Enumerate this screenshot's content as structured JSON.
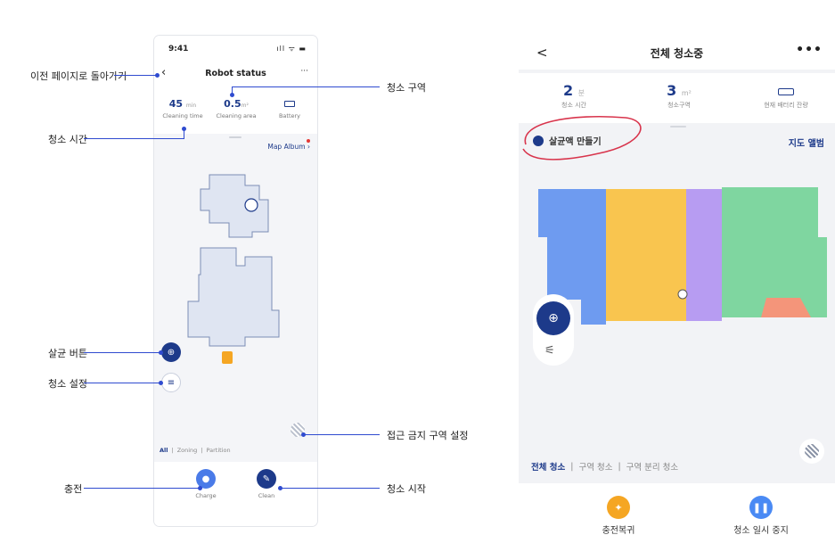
{
  "left_phone": {
    "status_time": "9:41",
    "status_icons": "ıll ᯤ ▬",
    "back_glyph": "‹",
    "title": "Robot status",
    "more_glyph": "···",
    "stats": [
      {
        "value": "45",
        "unit": "min",
        "label": "Cleaning time"
      },
      {
        "value": "0.5",
        "unit": "m²",
        "label": "Cleaning area"
      },
      {
        "value": "",
        "unit": "",
        "label": "Battery"
      }
    ],
    "map_album": "Map Album ›",
    "modes": {
      "all": "All",
      "zoning": "Zoning",
      "partition": "Partition"
    },
    "actions": [
      {
        "label": "Charge",
        "color": "#4a7be8"
      },
      {
        "label": "Clean",
        "color": "#1d3a8a"
      }
    ]
  },
  "annotations": {
    "back": "이전 페이지로 돌아가기",
    "area": "청소 구역",
    "time": "청소 시간",
    "disinfect": "살균 버튼",
    "settings": "청소 설정",
    "forbidden": "접근 금지 구역 설정",
    "charge": "충전",
    "start": "청소 시작"
  },
  "right_phone": {
    "back_glyph": "<",
    "title": "전체 청소중",
    "more_glyph": "•••",
    "stats": [
      {
        "value": "2",
        "unit": "분",
        "label": "청소 시간"
      },
      {
        "value": "3",
        "unit": "m²",
        "label": "청소구역"
      },
      {
        "value": "",
        "unit": "",
        "label": "현재 배터리 잔량"
      }
    ],
    "make_solution": "살균액 만들기",
    "map_album": "지도 앨범",
    "settings_glyph": "⚟",
    "modes": {
      "all": "전체 청소",
      "zone": "구역 청소",
      "partition": "구역 분리 청소"
    },
    "actions": [
      {
        "label": "충전복귀",
        "color": "#f5a623"
      },
      {
        "label": "청소 일시 중지",
        "color": "#4a8af4"
      }
    ],
    "room_colors": [
      "#6e9bf0",
      "#f9c54f",
      "#b79cf2",
      "#7fd6a0",
      "#f4957a"
    ]
  }
}
